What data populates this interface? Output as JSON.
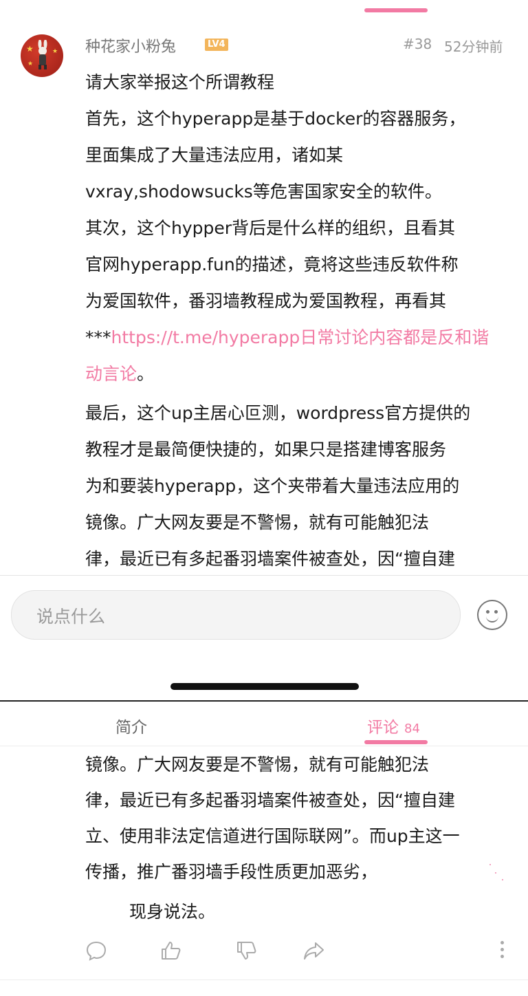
{
  "comment": {
    "username": "种花家小粉兔",
    "level": "LV4",
    "floor": "#38",
    "time": "52分钟前",
    "lines": [
      "请大家举报这个所谓教程",
      "首先，这个hyperapp是基于docker的容器服务，",
      "里面集成了大量违法应用，诸如某",
      "vxray,shodowsucks等危害国家安全的软件。",
      "其次，这个hypper背后是什么样的组织，且看其",
      "官网hyperapp.fun的描述，竟将这些违反软件称",
      "为爱国软件，番羽墙教程成为爱国教程，再看其"
    ],
    "line8_prefix": "***",
    "line8_link": "https://t.me/hyperapp日常讨论内容都是反和谐",
    "line9_link": "动言论",
    "line9_suffix": "。",
    "lines_after": [
      "最后，这个up主居心叵测，wordpress官方提供的",
      "教程才是最简便快捷的，如果只是搭建博客服务",
      "为和要装hyperapp，这个夹带着大量违法应用的",
      "镜像。广大网友要是不警惕，就有可能触犯法",
      "律，最近已有多起番羽墙案件被查处，因“擅自建"
    ]
  },
  "composer": {
    "placeholder": "说点什么",
    "emoji_icon": "smiley-face-icon"
  },
  "tabs": {
    "intro": "简介",
    "comments": "评论",
    "comments_count": "84"
  },
  "continuation_lines": [
    "镜像。广大网友要是不警惕，就有可能触犯法",
    "律，最近已有多起番羽墙案件被查处，因“擅自建",
    "立、使用非法定信道进行国际联网”。而up主这一",
    "传播，推广番羽墙手段性质更加恶劣，",
    "现身说法。"
  ],
  "actions": [
    "reply-icon",
    "like-icon",
    "dislike-icon",
    "share-icon",
    "more-icon"
  ],
  "colors": {
    "accent": "#f27aa3",
    "text": "#1a1a1a",
    "muted": "#999999",
    "level_badge": "#f3b55b"
  }
}
